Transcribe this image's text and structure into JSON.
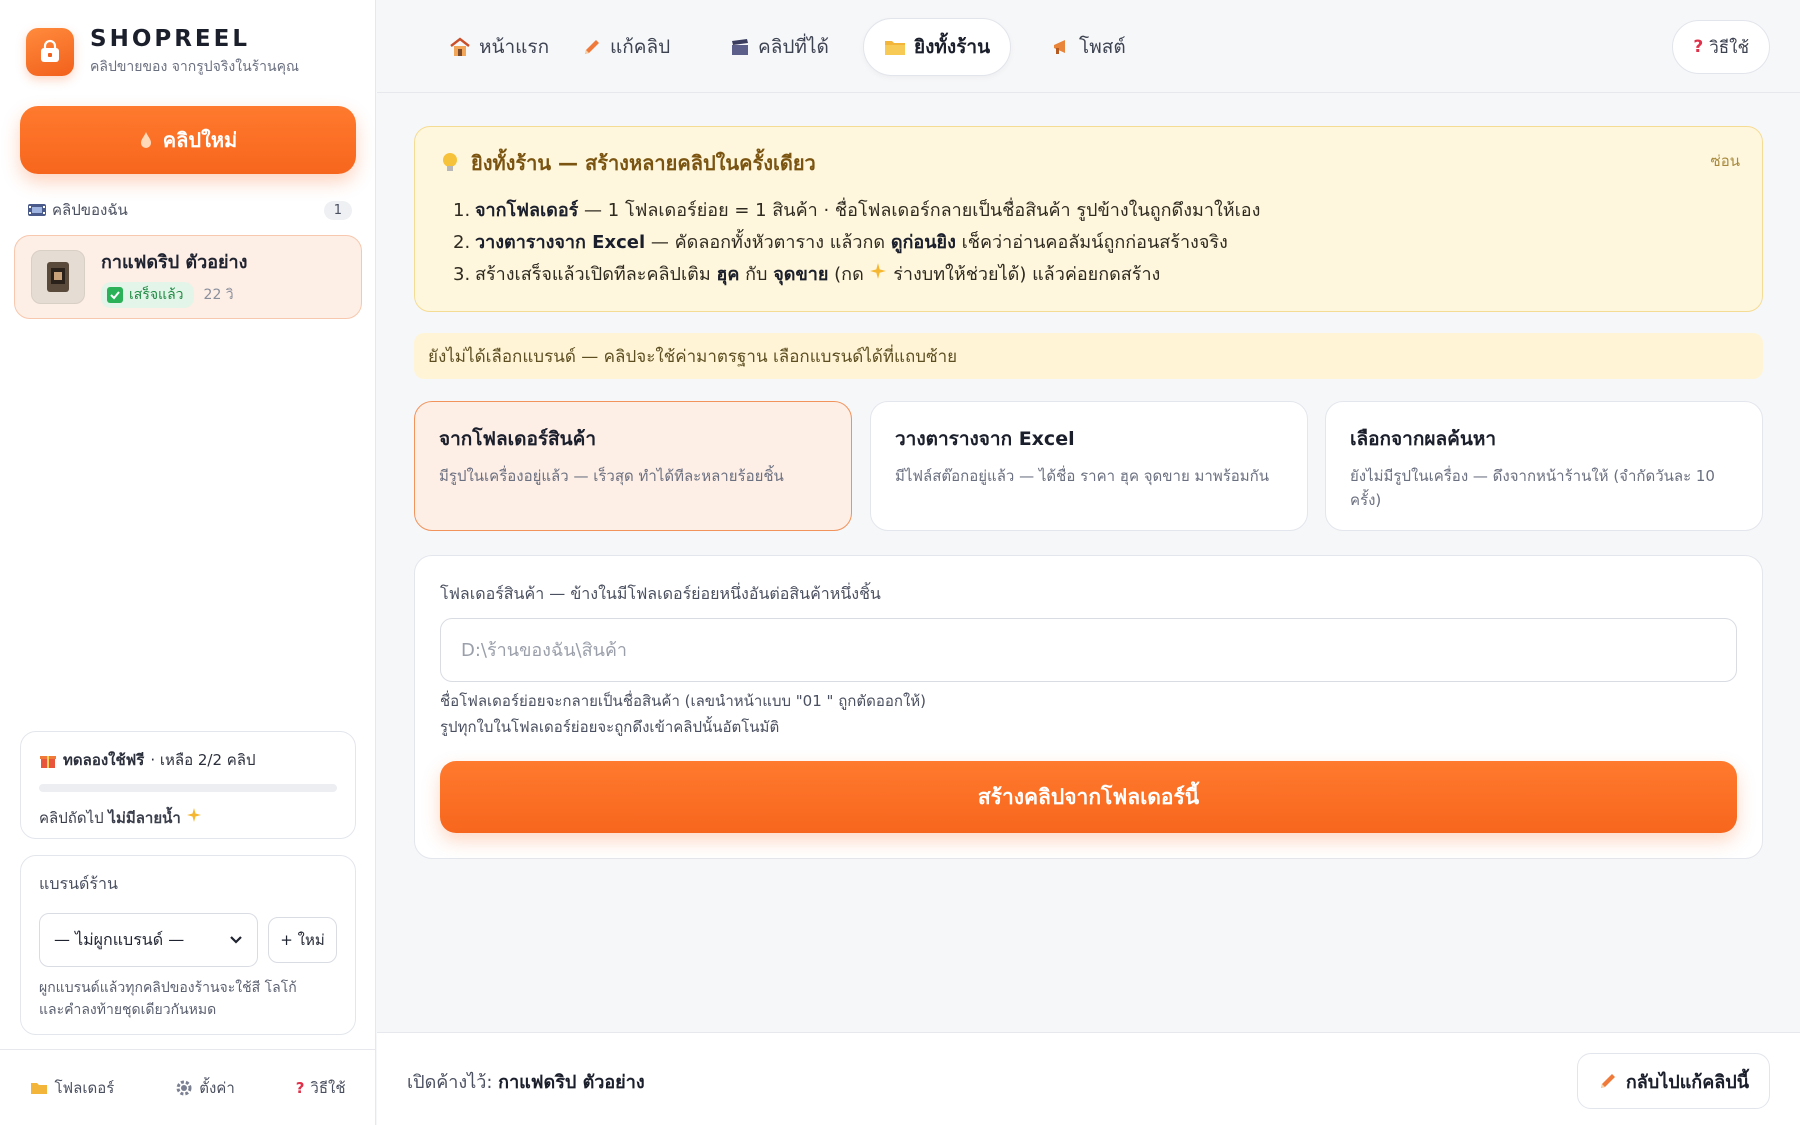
{
  "sidebar": {
    "brand_name": "SHOPREEL",
    "brand_tagline": "คลิปขายของ จากรูปจริงในร้านคุณ",
    "new_clip_label": "คลิปใหม่",
    "my_clips_label": "คลิปของฉัน",
    "my_clips_count": "1",
    "clips": [
      {
        "title": "กาแฟดริป ตัวอย่าง",
        "status": "เสร็จแล้ว",
        "age": "22 วิ"
      }
    ],
    "trial": {
      "label": "ทดลองใช้ฟรี",
      "remaining": "· เหลือ 2/2 คลิป",
      "progress": 0,
      "next_prefix": "คลิปถัดไป",
      "next_bold": "ไม่มีลายน้ำ"
    },
    "brand_section": {
      "title": "แบรนด์ร้าน",
      "select_value": "— ไม่ผูกแบรนด์ —",
      "new_button": "+ ใหม่",
      "help_line1": "ผูกแบรนด์แล้วทุกคลิปของร้านจะใช้สี โลโก้",
      "help_line2": "และคำลงท้ายชุดเดียวกันหมด"
    },
    "footer": {
      "folder": "โฟลเดอร์",
      "settings": "ตั้งค่า",
      "help": "วิธีใช้"
    }
  },
  "topnav": {
    "tabs": [
      {
        "label": "หน้าแรก",
        "icon": "house-icon"
      },
      {
        "label": "แก้คลิป",
        "icon": "pencil-icon"
      },
      {
        "label": "คลิปที่ได้",
        "icon": "clapper-icon"
      },
      {
        "label": "ยิงทั้งร้าน",
        "icon": "folder-icon"
      },
      {
        "label": "โพสต์",
        "icon": "megaphone-icon"
      }
    ],
    "active_tab": "ยิงทั้งร้าน",
    "help_label": "วิธีใช้"
  },
  "tip": {
    "title": "ยิงทั้งร้าน — สร้างหลายคลิปในครั้งเดียว",
    "hide_label": "ซ่อน",
    "steps": [
      {
        "num": "1.",
        "bold": "จากโฟลเดอร์",
        "rest": " — 1 โฟลเดอร์ย่อย = 1 สินค้า · ชื่อโฟลเดอร์กลายเป็นชื่อสินค้า รูปข้างในถูกดึงมาให้เอง"
      },
      {
        "num": "2.",
        "bold": "วางตารางจาก Excel",
        "mid": " — คัดลอกทั้งหัวตาราง แล้วกด ",
        "bold2": "ดูก่อนยิง",
        "rest": " เช็คว่าอ่านคอลัมน์ถูกก่อนสร้างจริง"
      },
      {
        "num": "3.",
        "pre": "สร้างเสร็จแล้วเปิดทีละคลิปเติม ",
        "bold": "ฮุค",
        "mid": " กับ ",
        "bold2": "จุดขาย",
        "mid2": " (กด ",
        "rest": " ร่างบทให้ช่วยได้) แล้วค่อยกดสร้าง"
      }
    ]
  },
  "warning": "ยังไม่ได้เลือกแบรนด์ — คลิปจะใช้ค่ามาตรฐาน เลือกแบรนด์ได้ที่แถบซ้าย",
  "modes": [
    {
      "title": "จากโฟลเดอร์สินค้า",
      "desc": "มีรูปในเครื่องอยู่แล้ว — เร็วสุด ทำได้ทีละหลายร้อยชิ้น",
      "active": true
    },
    {
      "title": "วางตารางจาก Excel",
      "desc": "มีไฟล์สต๊อกอยู่แล้ว — ได้ชื่อ ราคา ฮุค จุดขาย มาพร้อมกัน",
      "active": false
    },
    {
      "title": "เลือกจากผลค้นหา",
      "desc": "ยังไม่มีรูปในเครื่อง — ดึงจากหน้าร้านให้ (จำกัดวันละ 10 ครั้ง)",
      "active": false
    }
  ],
  "folder": {
    "label": "โฟลเดอร์สินค้า — ข้างในมีโฟลเดอร์ย่อยหนึ่งอันต่อสินค้าหนึ่งชิ้น",
    "placeholder": "D:\\ร้านของฉัน\\สินค้า",
    "value": "",
    "hint1": "ชื่อโฟลเดอร์ย่อยจะกลายเป็นชื่อสินค้า (เลขนำหน้าแบบ \"01 \" ถูกตัดออกให้)",
    "hint2": "รูปทุกใบในโฟลเดอร์ย่อยจะถูกดึงเข้าคลิปนั้นอัตโนมัติ",
    "create_label": "สร้างคลิปจากโฟลเดอร์นี้"
  },
  "bottom": {
    "open_prefix": "เปิดค้างไว้:",
    "open_clip": "กาแฟดริป ตัวอย่าง",
    "back_label": "กลับไปแก้คลิปนี้"
  },
  "colors": {
    "accent": "#f7661d",
    "tip_bg": "#fff7dd",
    "success": "#2bb259"
  }
}
